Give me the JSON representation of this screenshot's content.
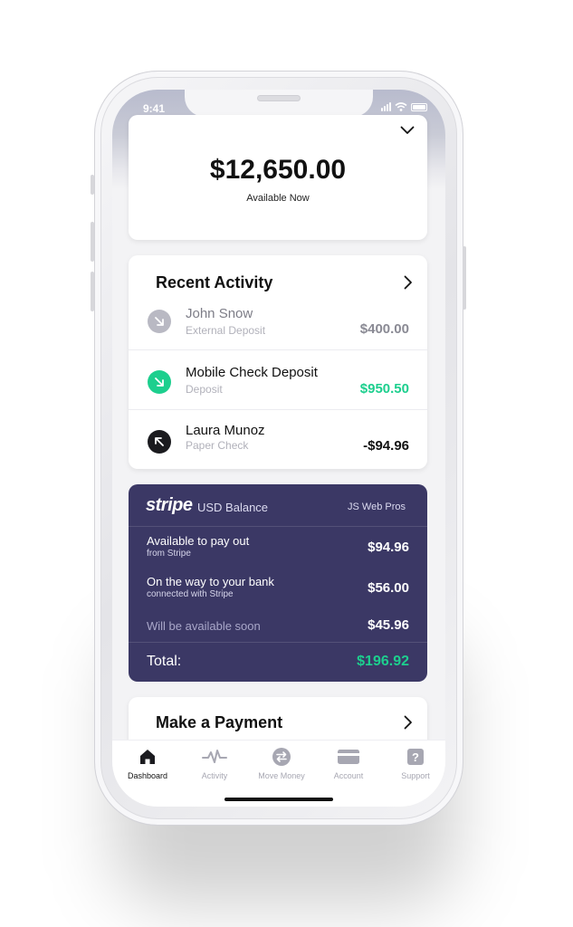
{
  "status_bar": {
    "time": "9:41"
  },
  "balance": {
    "amount": "$12,650.00",
    "label": "Available Now"
  },
  "recent_activity": {
    "title": "Recent Activity",
    "items": [
      {
        "name": "John Snow",
        "subtitle": "External Deposit",
        "amount": "$400.00",
        "icon": "arrow-down-right-icon",
        "icon_color": "#b9b9c3",
        "amount_color": "#8a8a94",
        "name_color": "#7d7d87"
      },
      {
        "name": "Mobile Check Deposit",
        "subtitle": "Deposit",
        "amount": "$950.50",
        "icon": "arrow-down-right-icon",
        "icon_color": "#1dcf8e",
        "amount_color": "#1dcf8e",
        "name_color": "#111111"
      },
      {
        "name": "Laura Munoz",
        "subtitle": "Paper Check",
        "amount": "-$94.96",
        "icon": "arrow-up-left-icon",
        "icon_color": "#1b1b1f",
        "amount_color": "#111111",
        "name_color": "#111111"
      }
    ]
  },
  "stripe_balance": {
    "logo": "stripe",
    "currency_label": "USD Balance",
    "account_name": "JS Web Pros",
    "rows": [
      {
        "label": "Available to pay out",
        "sub": "from Stripe",
        "amount": "$94.96"
      },
      {
        "label": "On the way to your bank",
        "sub": "connected with Stripe",
        "amount": "$56.00"
      },
      {
        "label": "Will be available soon",
        "sub": "",
        "amount": "$45.96"
      }
    ],
    "total_label": "Total:",
    "total_amount": "$196.92",
    "card_color": "#3b3865",
    "total_color": "#1dcf8e"
  },
  "make_payment": {
    "title": "Make a Payment"
  },
  "tab_bar": {
    "tabs": [
      {
        "label": "Dashboard",
        "icon": "home-icon",
        "active": true
      },
      {
        "label": "Activity",
        "icon": "pulse-icon",
        "active": false
      },
      {
        "label": "Move Money",
        "icon": "transfer-icon",
        "active": false
      },
      {
        "label": "Account",
        "icon": "card-icon",
        "active": false
      },
      {
        "label": "Support",
        "icon": "help-icon",
        "active": false
      }
    ]
  }
}
